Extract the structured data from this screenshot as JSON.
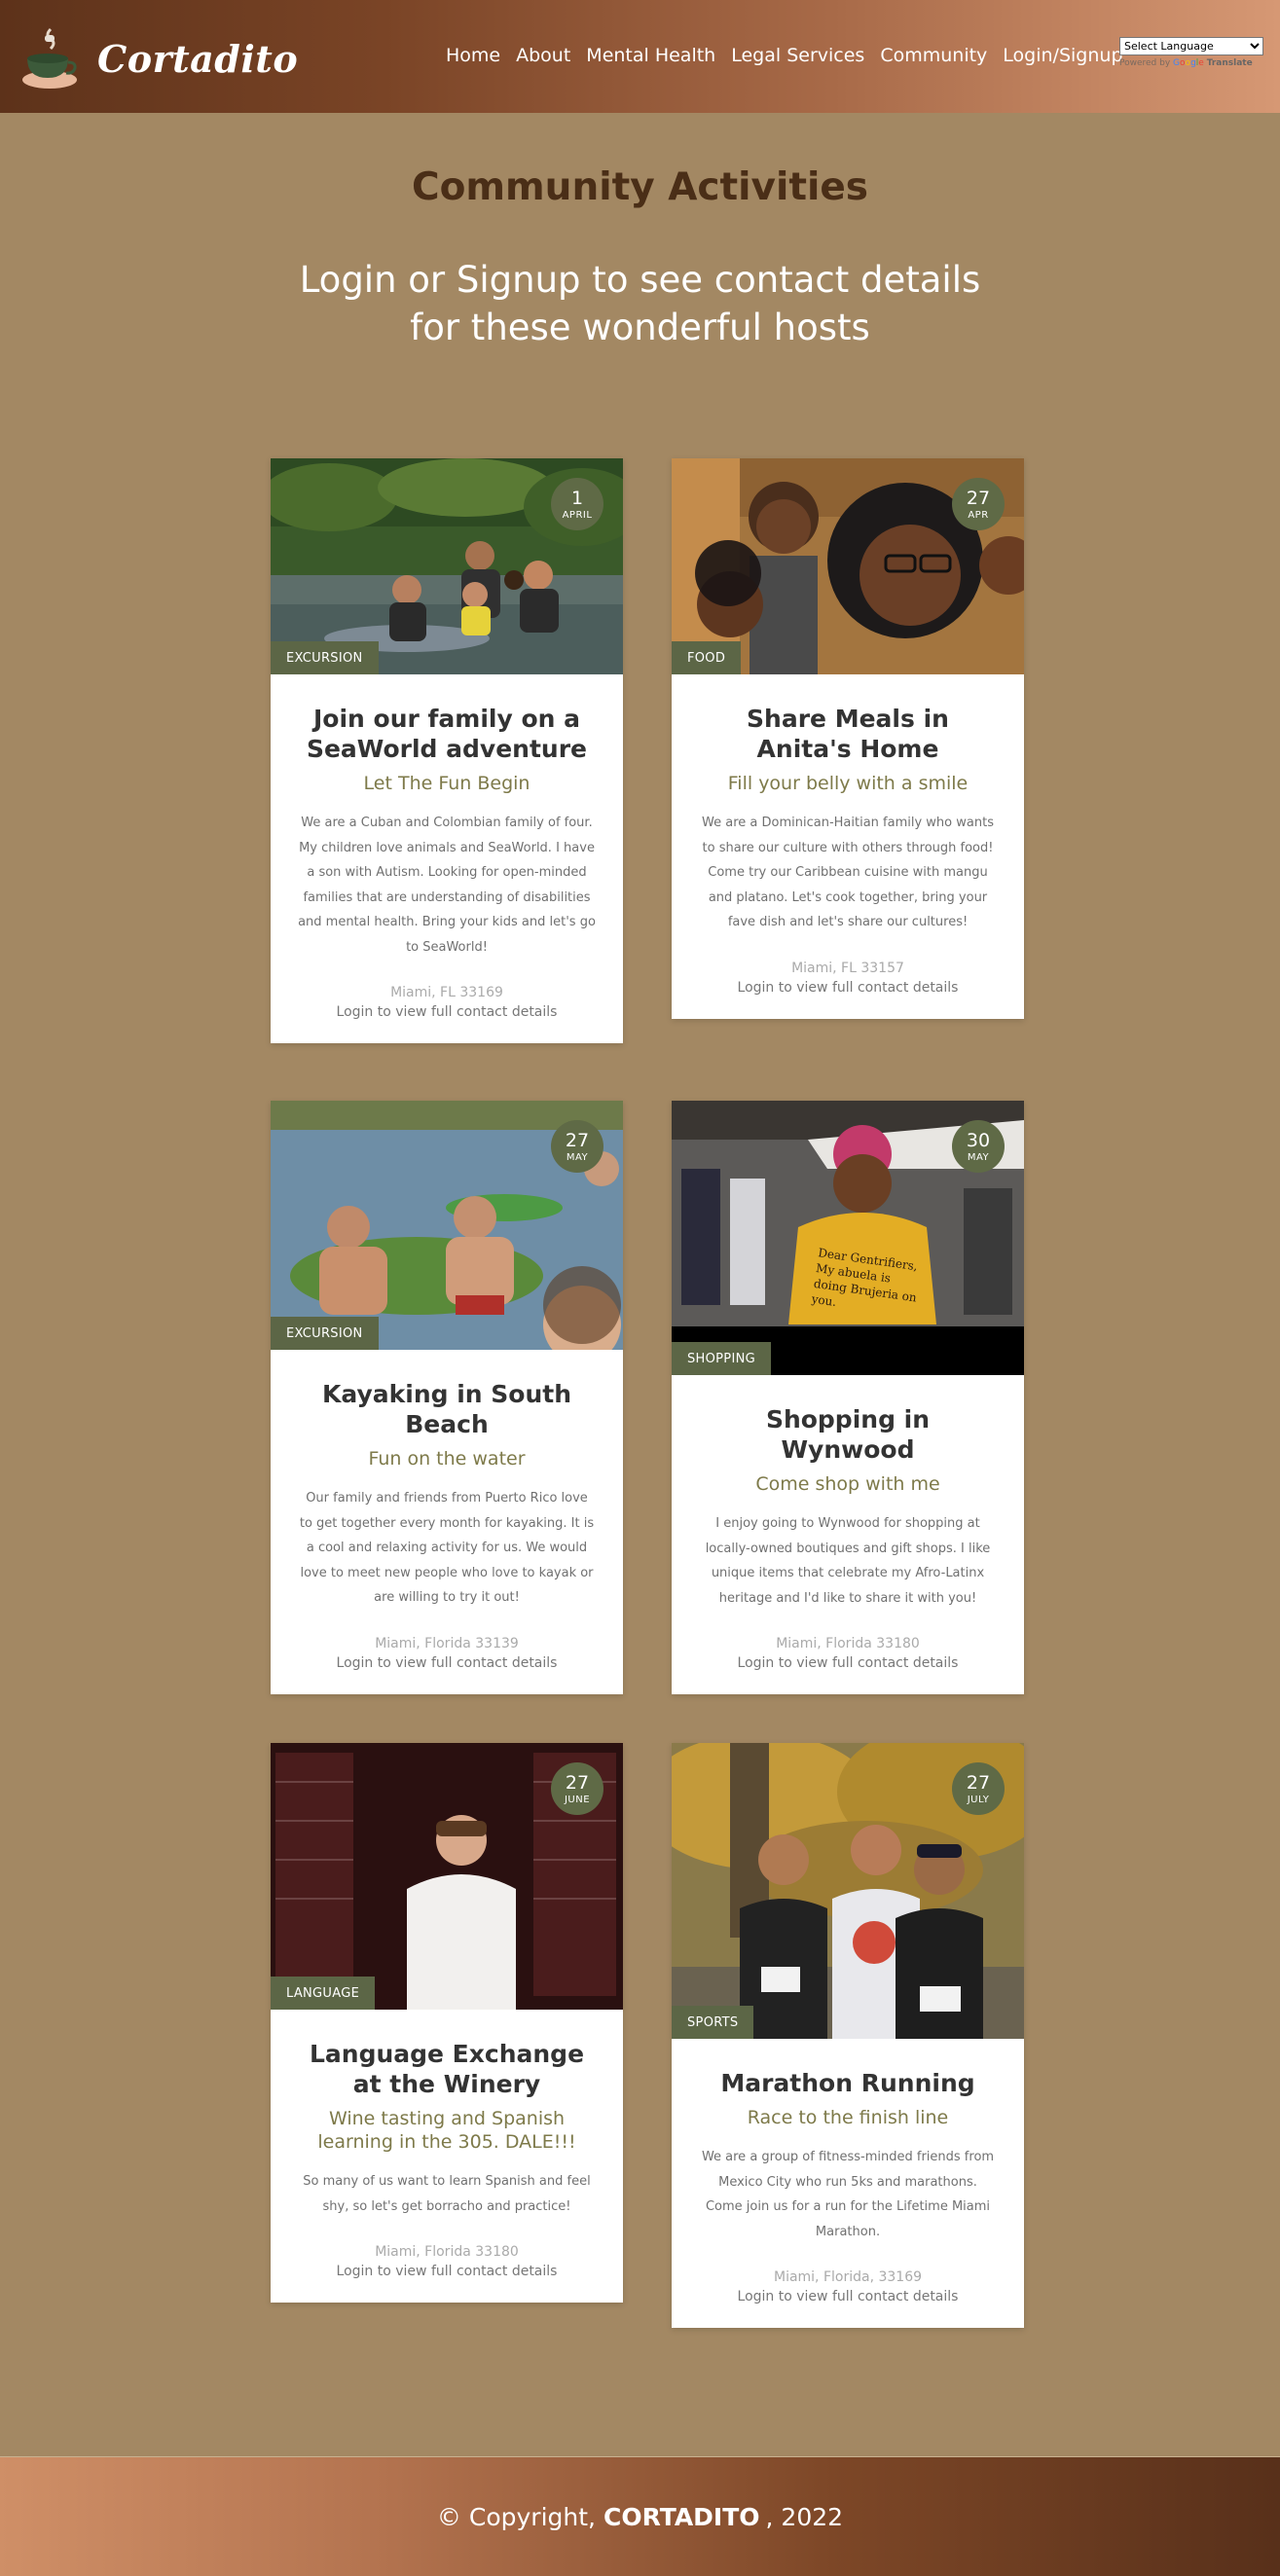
{
  "brand": {
    "name": "Cortadito"
  },
  "nav": [
    "Home",
    "About",
    "Mental Health",
    "Legal Services",
    "Community",
    "Login/Signup"
  ],
  "translate": {
    "select_label": "Select Language",
    "powered_by": "Powered by",
    "google": "Google",
    "translate": "Translate"
  },
  "page": {
    "title": "Community Activities",
    "subtitle": "Login or Signup to see contact details for these wonderful hosts"
  },
  "cards": [
    {
      "day": "1",
      "month": "APRIL",
      "category": "EXCURSION",
      "title": "Join our family on a SeaWorld adventure",
      "tagline": "Let The Fun Begin",
      "description": "We are a Cuban and Colombian family of four. My children love animals and SeaWorld. I have a son with Autism. Looking for open-minded families that are understanding of disabilities and mental health. Bring your kids and let's go to SeaWorld!",
      "location": "Miami, FL 33169",
      "login": "Login to view full contact details"
    },
    {
      "day": "27",
      "month": "APR",
      "category": "FOOD",
      "title": "Share Meals in Anita's Home",
      "tagline": "Fill your belly with a smile",
      "description": "We are a Dominican-Haitian family who wants to share our culture with others through food! Come try our Caribbean cuisine with mangu and platano. Let's cook together, bring your fave dish and let's share our cultures!",
      "location": "Miami, FL 33157",
      "login": "Login to view full contact details"
    },
    {
      "day": "27",
      "month": "MAY",
      "category": "EXCURSION",
      "title": "Kayaking in South Beach",
      "tagline": "Fun on the water",
      "description": "Our family and friends from Puerto Rico love to get together every month for kayaking. It is a cool and relaxing activity for us. We would love to meet new people who love to kayak or are willing to try it out!",
      "location": "Miami, Florida 33139",
      "login": "Login to view full contact details"
    },
    {
      "day": "30",
      "month": "MAY",
      "category": "SHOPPING",
      "title": "Shopping in Wynwood",
      "tagline": "Come shop with me",
      "description": "I enjoy going to Wynwood for shopping at locally-owned boutiques and gift shops. I like unique items that celebrate my Afro-Latinx heritage and I'd like to share it with you!",
      "location": "Miami, Florida 33180",
      "login": "Login to view full contact details",
      "shirt_text": "Dear Gentrifiers, My abuela is doing Brujeria on you."
    },
    {
      "day": "27",
      "month": "JUNE",
      "category": "LANGUAGE",
      "title": "Language Exchange at the Winery",
      "tagline": "Wine tasting and Spanish learning in the 305. DALE!!!",
      "description": "So many of us want to learn Spanish and feel shy, so let's get borracho and practice!",
      "location": "Miami, Florida 33180",
      "login": "Login to view full contact details"
    },
    {
      "day": "27",
      "month": "JULY",
      "category": "SPORTS",
      "title": "Marathon Running",
      "tagline": "Race to the finish line",
      "description": "We are a group of fitness-minded friends from Mexico City who run 5ks and marathons. Come join us for a run for the Lifetime Miami Marathon.",
      "location": "Miami, Florida, 33169",
      "login": "Login to view full contact details"
    }
  ],
  "footer": {
    "copyright": "© Copyright,",
    "brand": "CORTADITO",
    "year": ", 2022"
  }
}
